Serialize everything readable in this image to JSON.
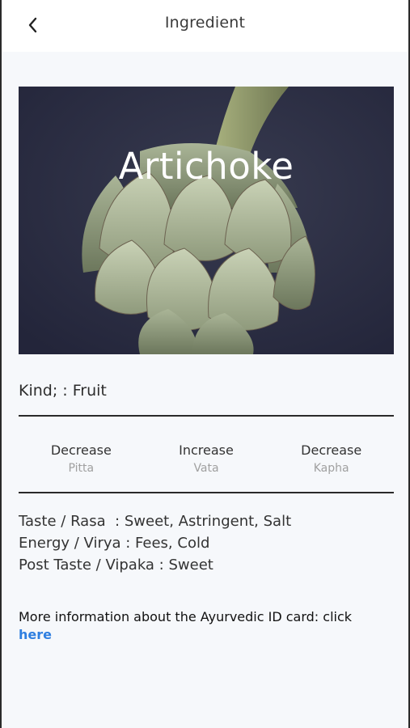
{
  "nav": {
    "title": "Ingredient"
  },
  "hero": {
    "title": "Artichoke"
  },
  "kind": {
    "text": "Kind; : Fruit"
  },
  "doshas": [
    {
      "effect": "Decrease",
      "name": "Pitta"
    },
    {
      "effect": "Increase",
      "name": "Vata"
    },
    {
      "effect": "Decrease",
      "name": "Kapha"
    }
  ],
  "properties": {
    "taste": "Taste / Rasa  : Sweet, Astringent, Salt",
    "energy": "Energy / Virya : Fees, Cold",
    "post_taste": "Post Taste / Vipaka : Sweet"
  },
  "more_info": {
    "text": "More information about the Ayurvedic ID card: click",
    "link": "here"
  },
  "colors": {
    "link": "#2f7fe0",
    "background": "#f6f8fb",
    "hero_background": "#2d2f40"
  },
  "icons": {
    "back": "chevron-left-icon"
  }
}
